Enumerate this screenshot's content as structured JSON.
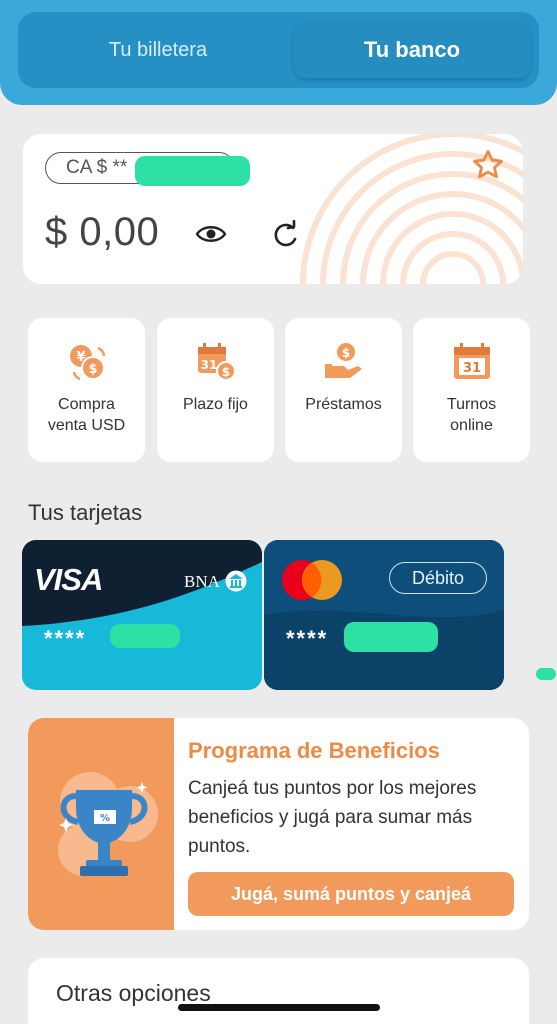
{
  "header": {
    "tabs": [
      {
        "label": "Tu billetera",
        "active": false
      },
      {
        "label": "Tu banco",
        "active": true
      }
    ]
  },
  "account": {
    "pill_text": "CA $ **",
    "balance": "$ 0,00"
  },
  "quick_actions": [
    {
      "label_line1": "Compra",
      "label_line2": "venta USD",
      "icon": "currency-exchange-icon"
    },
    {
      "label_line1": "Plazo fijo",
      "label_line2": "",
      "icon": "calendar-money-icon"
    },
    {
      "label_line1": "Préstamos",
      "label_line2": "",
      "icon": "hand-money-icon"
    },
    {
      "label_line1": "Turnos",
      "label_line2": "online",
      "icon": "calendar-31-icon"
    }
  ],
  "cards_section": {
    "title": "Tus tarjetas",
    "cards": [
      {
        "brand": "VISA",
        "bank": "BNA",
        "masked": "****"
      },
      {
        "brand": "mastercard",
        "badge": "Débito",
        "masked": "****"
      }
    ]
  },
  "benefits": {
    "title": "Programa de Beneficios",
    "text": "Canjeá tus puntos por los mejores beneficios y jugá para sumar más puntos.",
    "button": "Jugá, sumá puntos y canjeá"
  },
  "other": {
    "title": "Otras opciones"
  },
  "colors": {
    "header": "#3aa8d8",
    "accent_orange": "#f29a5c",
    "visa_card": "#17b9d8",
    "debit_card": "#0d4f7a"
  }
}
